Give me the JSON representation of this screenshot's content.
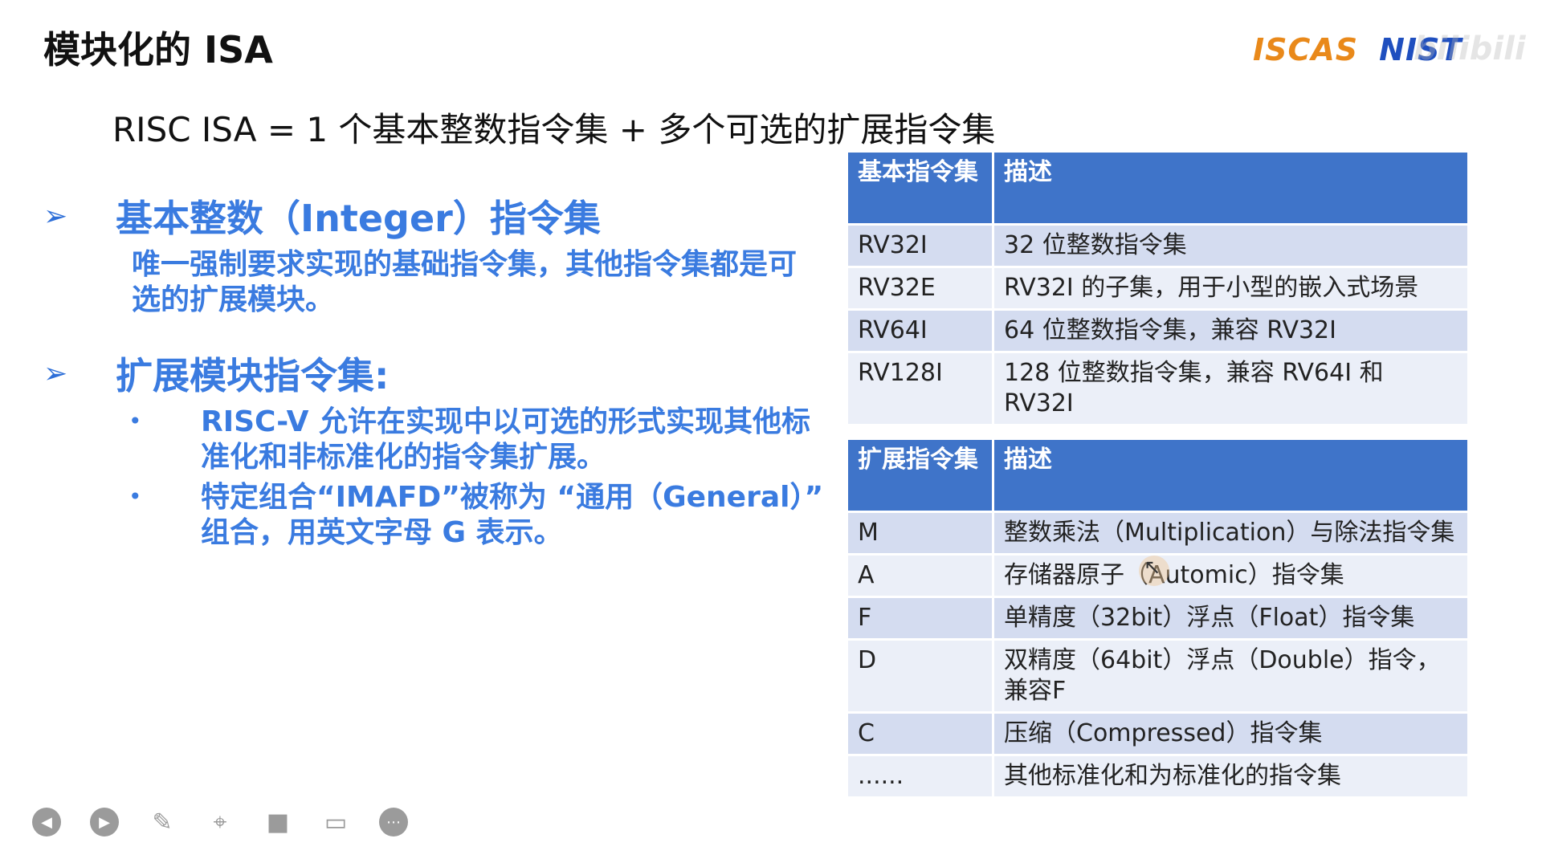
{
  "slide": {
    "title": "模块化的 ISA",
    "formula": "RISC ISA = 1 个基本整数指令集 + 多个可选的扩展指令集",
    "logos": {
      "iscas": "ISCAS",
      "nist": "NIST",
      "watermark": "bilibili"
    }
  },
  "sections": {
    "base": {
      "arrow": "➢",
      "heading": "基本整数（Integer）指令集",
      "body": "唯一强制要求实现的基础指令集，其他指令集都是可选的扩展模块。"
    },
    "ext": {
      "arrow": "➢",
      "heading": "扩展模块指令集:",
      "bullets": [
        "RISC-V 允许在实现中以可选的形式实现其他标准化和非标准化的指令集扩展。",
        "特定组合“IMAFD”被称为 “通用（General）” 组合，用英文字母 G 表示。"
      ]
    }
  },
  "base_table": {
    "headers": [
      "基本指令集",
      "描述"
    ],
    "rows": [
      [
        "RV32I",
        "32 位整数指令集"
      ],
      [
        "RV32E",
        "RV32I 的子集，用于小型的嵌入式场景"
      ],
      [
        "RV64I",
        "64 位整数指令集，兼容 RV32I"
      ],
      [
        "RV128I",
        "128 位整数指令集，兼容 RV64I 和 RV32I"
      ]
    ]
  },
  "ext_table": {
    "headers": [
      "扩展指令集",
      "描述"
    ],
    "rows": [
      [
        "M",
        "整数乘法（Multiplication）与除法指令集"
      ],
      [
        "A",
        "存储器原子（Automic）指令集"
      ],
      [
        "F",
        "单精度（32bit）浮点（Float）指令集"
      ],
      [
        "D",
        "双精度（64bit）浮点（Double）指令，兼容F"
      ],
      [
        "C",
        "压缩（Compressed）指令集"
      ],
      [
        "......",
        "其他标准化和为标准化的指令集"
      ]
    ]
  },
  "toolbar": {
    "icons": [
      "prev-icon",
      "next-icon",
      "pen-icon",
      "screenshot-icon",
      "camera-icon",
      "comment-icon",
      "more-icon"
    ],
    "glyphs": [
      "◀",
      "▶",
      "✎",
      "⌖",
      "■",
      "▭",
      "⋯"
    ]
  }
}
